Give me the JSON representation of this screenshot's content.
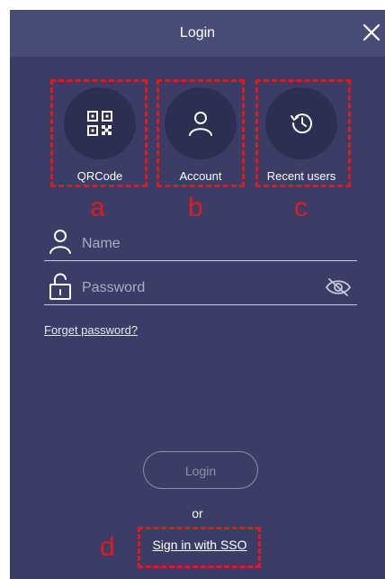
{
  "header": {
    "title": "Login"
  },
  "login_options": [
    {
      "label": "QRCode",
      "icon": "qr-code-icon"
    },
    {
      "label": "Account",
      "icon": "user-icon"
    },
    {
      "label": "Recent users",
      "icon": "history-icon"
    }
  ],
  "annotations": {
    "a": "a",
    "b": "b",
    "c": "c",
    "d": "d"
  },
  "form": {
    "name_placeholder": "Name",
    "password_placeholder": "Password",
    "forget_password": "Forget password?"
  },
  "actions": {
    "login_label": "Login",
    "or_label": "or",
    "sso_label": "Sign in with SSO"
  },
  "colors": {
    "panel_bg": "#3b3d67",
    "titlebar_bg": "#4a4c78",
    "option_bg": "#2d2f52",
    "annotation": "#e01a1a"
  }
}
